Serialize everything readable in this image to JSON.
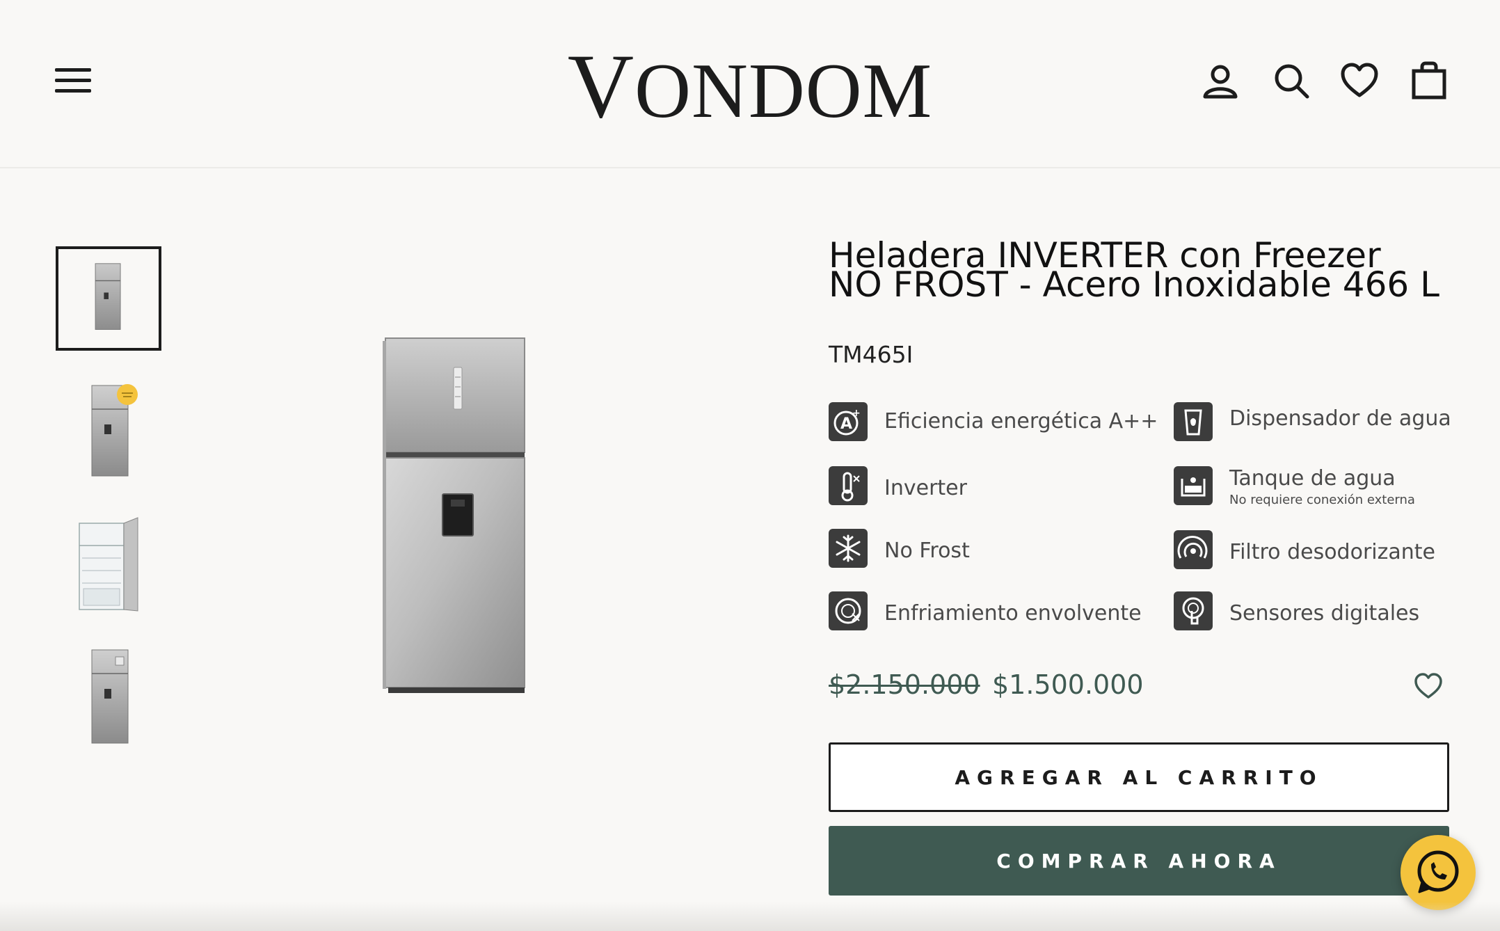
{
  "header": {
    "logo_first": "V",
    "logo_rest": "ONDOM",
    "menu_icon": "hamburger-icon",
    "account_icon": "user-icon",
    "search_icon": "search-icon",
    "wishlist_icon": "heart-icon",
    "cart_icon": "shopping-bag-icon"
  },
  "gallery": {
    "thumbnails": [
      {
        "name": "fridge-front",
        "active": true
      },
      {
        "name": "fridge-front-badge",
        "active": false,
        "badge_color": "#f4c33d"
      },
      {
        "name": "fridge-open",
        "active": false
      },
      {
        "name": "fridge-side",
        "active": false
      }
    ]
  },
  "product": {
    "title": "Heladera INVERTER con Freezer NO FROST - Acero Inoxidable 466 L",
    "sku": "TM465I",
    "features": [
      {
        "label": "Eficiencia energética A++",
        "icon": "energy-efficiency-icon"
      },
      {
        "label": "Dispensador de agua",
        "icon": "water-dispenser-icon"
      },
      {
        "label": "Inverter",
        "icon": "inverter-thermometer-icon"
      },
      {
        "label": "Tanque de agua",
        "sub": "No requiere conexión externa",
        "icon": "water-tank-icon"
      },
      {
        "label": "No Frost",
        "icon": "no-frost-icon"
      },
      {
        "label": "Filtro desodorizante",
        "icon": "deodorizing-filter-icon"
      },
      {
        "label": "Enfriamiento  envolvente",
        "icon": "surround-cooling-icon"
      },
      {
        "label": "Sensores digitales",
        "icon": "digital-sensor-icon"
      }
    ],
    "old_price": "$2.150.000",
    "price": "$1.500.000",
    "add_to_cart": "AGREGAR AL CARRITO",
    "buy_now": "COMPRAR AHORA"
  },
  "colors": {
    "accent": "#3f5a52",
    "whatsapp": "#f4c33d",
    "text": "#1c1c1c",
    "background": "#f9f8f6"
  },
  "floating": {
    "whatsapp_icon": "whatsapp-icon"
  }
}
